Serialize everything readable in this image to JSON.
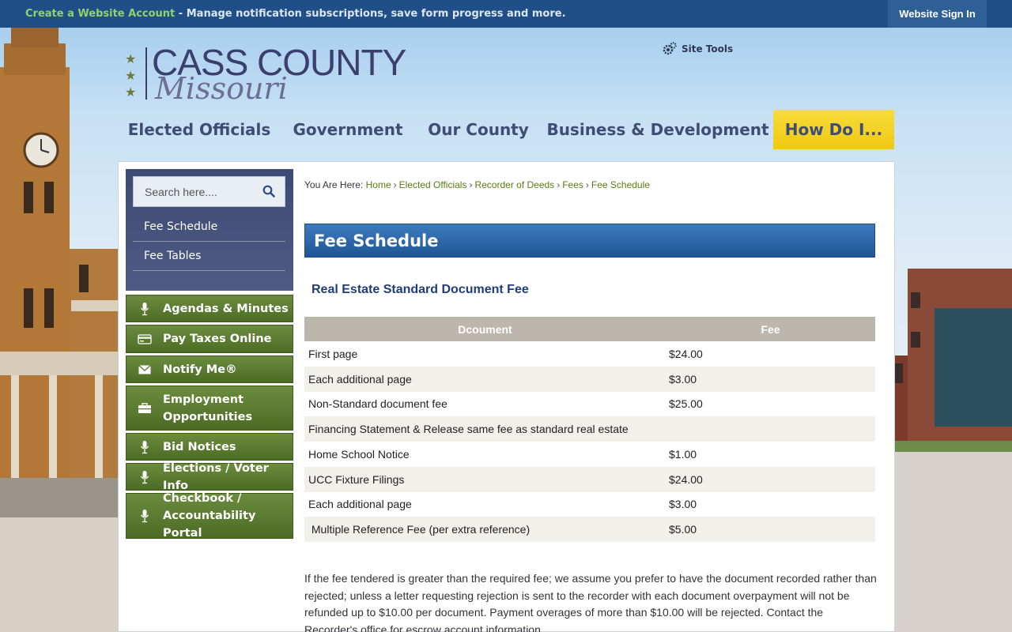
{
  "topbar": {
    "promo_link": "Create a Website Account",
    "promo_text": " - Manage notification subscriptions, save form progress and more.",
    "signin": "Website Sign In"
  },
  "logo": {
    "line1": "CASS COUNTY",
    "line2": "Missouri"
  },
  "site_tools": "Site Tools",
  "nav": [
    {
      "label": "Elected Officials"
    },
    {
      "label": "Government"
    },
    {
      "label": "Our County"
    },
    {
      "label": "Business & Development"
    },
    {
      "label": "How Do I..."
    }
  ],
  "sidebar": {
    "search_placeholder": "Search here....",
    "links": [
      {
        "label": "Fee Schedule"
      },
      {
        "label": "Fee Tables"
      }
    ],
    "quick_links": [
      {
        "label": "Agendas & Minutes",
        "icon": "microphone-icon"
      },
      {
        "label": "Pay Taxes Online",
        "icon": "credit-card-icon"
      },
      {
        "label": "Notify Me®",
        "icon": "envelope-icon"
      },
      {
        "label": "Employment Opportunities",
        "icon": "briefcase-icon"
      },
      {
        "label": "Bid Notices",
        "icon": "microphone-icon"
      },
      {
        "label": "Elections / Voter Info",
        "icon": "microphone-icon"
      },
      {
        "label": "Checkbook / Accountability Portal",
        "icon": "microphone-icon"
      }
    ]
  },
  "breadcrumb": {
    "prefix": "You Are Here:",
    "items": [
      "Home",
      "Elected Officials",
      "Recorder of Deeds",
      "Fees",
      "Fee Schedule"
    ]
  },
  "page_title": "Fee Schedule",
  "subheading": "Real Estate Standard Document Fee",
  "table": {
    "headers": [
      "Dcoument",
      "Fee"
    ],
    "rows": [
      {
        "doc": "First page",
        "fee": "$24.00"
      },
      {
        "doc": "Each additional page",
        "fee": "$3.00"
      },
      {
        "doc": "Non-Standard document fee",
        "fee": "$25.00"
      },
      {
        "doc": "Financing Statement & Release same fee as standard real estate",
        "fee": ""
      },
      {
        "doc": "Home School Notice",
        "fee": "$1.00"
      },
      {
        "doc": "UCC Fixture Filings",
        "fee": "$24.00"
      },
      {
        "doc": "Each additional page",
        "fee": "$3.00"
      },
      {
        "doc": " Multiple Reference Fee (per extra reference)",
        "fee": "$5.00"
      }
    ]
  },
  "note": "If the fee tendered is greater than the required fee; we assume you prefer to have the document recorded rather than rejected; unless a letter requesting rejection is sent to the recorder with each document overpayment will not be refunded up to $10.00 per document. Payment overages of more than $10.00 will be rejected. Contact the Recorder's office for escrow account information."
}
